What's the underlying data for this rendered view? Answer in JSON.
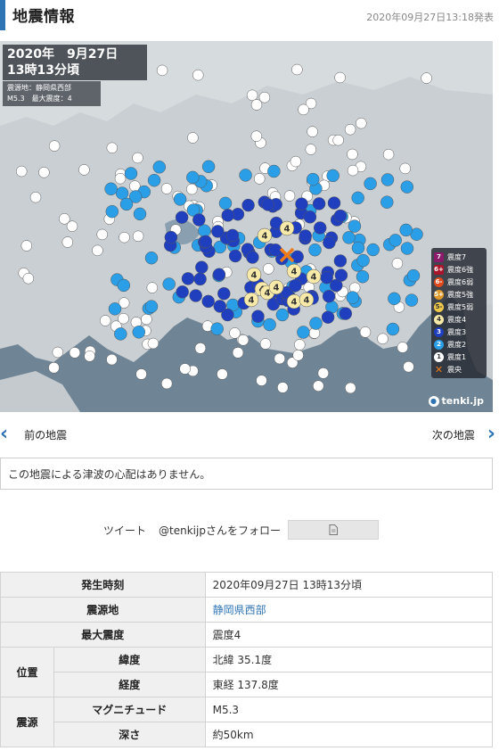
{
  "header": {
    "title": "地震情報",
    "issued": "2020年09月27日13:18発表"
  },
  "map": {
    "datetime_line1": "2020年　9月27日",
    "datetime_line2": "13時13分頃",
    "epicenter_label": "震源地：静岡県西部",
    "magnitude_label": "M5.3　最大震度：4",
    "brand": "tenki.jp",
    "legend": [
      {
        "glyph": "7",
        "label": "震度7",
        "color": "#8b1a6b"
      },
      {
        "glyph": "6+",
        "label": "震度6強",
        "color": "#a8152a"
      },
      {
        "glyph": "6-",
        "label": "震度6弱",
        "color": "#e04a1a"
      },
      {
        "glyph": "5+",
        "label": "震度5強",
        "color": "#e09a2a"
      },
      {
        "glyph": "5-",
        "label": "震度5弱",
        "color": "#f0c94a"
      },
      {
        "glyph": "4",
        "label": "震度4",
        "color": "#f7e9a8"
      },
      {
        "glyph": "3",
        "label": "震度3",
        "color": "#1f3fbf"
      },
      {
        "glyph": "2",
        "label": "震度2",
        "color": "#2a9ee6"
      },
      {
        "glyph": "1",
        "label": "震度1",
        "color": "#ffffff"
      },
      {
        "glyph": "✕",
        "label": "震央",
        "color": "#f07a1a"
      }
    ]
  },
  "nav": {
    "prev_label": "前の地震",
    "next_label": "次の地震"
  },
  "tsunami_notice": "この地震による津波の心配はありません。",
  "social": {
    "tweet": "ツイート",
    "follow": "@tenkijpさんをフォロー",
    "button_icon": "document-icon"
  },
  "details": {
    "occurred_label": "発生時刻",
    "occurred_value": "2020年09月27日 13時13分頃",
    "epicenter_label": "震源地",
    "epicenter_value": "静岡県西部",
    "max_intensity_label": "最大震度",
    "max_intensity_value": "震度4",
    "position_label": "位置",
    "latitude_label": "緯度",
    "latitude_value": "北緯 35.1度",
    "longitude_label": "経度",
    "longitude_value": "東経 137.8度",
    "source_label": "震源",
    "magnitude_label": "マグニチュード",
    "magnitude_value": "M5.3",
    "depth_label": "深さ",
    "depth_value": "約50km"
  }
}
